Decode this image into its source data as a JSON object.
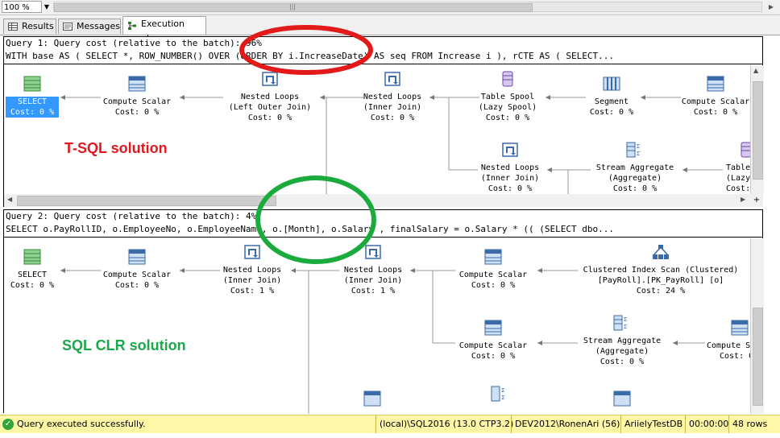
{
  "toolbar": {
    "zoom": "100 %"
  },
  "tabs": [
    {
      "label": "Results"
    },
    {
      "label": "Messages"
    },
    {
      "label": "Execution plan"
    }
  ],
  "query1": {
    "header": "Query 1: Query cost (relative to the batch): 96%",
    "sql": "WITH base AS ( SELECT *, ROW_NUMBER() OVER (ORDER BY i.IncreaseDate) AS seq FROM Increase i ), rCTE AS ( SELECT...",
    "nodes": [
      {
        "id": "select",
        "lines": [
          "SELECT",
          "Cost: 0 %"
        ],
        "icon": "select-icon"
      },
      {
        "id": "compute1",
        "lines": [
          "Compute Scalar",
          "Cost: 0 %"
        ],
        "icon": "compute-scalar-icon"
      },
      {
        "id": "nested1",
        "lines": [
          "Nested Loops",
          "(Left Outer Join)",
          "Cost: 0 %"
        ],
        "icon": "nested-loops-icon"
      },
      {
        "id": "nested2",
        "lines": [
          "Nested Loops",
          "(Inner Join)",
          "Cost: 0 %"
        ],
        "icon": "nested-loops-icon"
      },
      {
        "id": "spool",
        "lines": [
          "Table Spool",
          "(Lazy Spool)",
          "Cost: 0 %"
        ],
        "icon": "table-spool-icon"
      },
      {
        "id": "segment",
        "lines": [
          "Segment",
          "Cost: 0 %"
        ],
        "icon": "segment-icon"
      },
      {
        "id": "compute2",
        "lines": [
          "Compute Scalar",
          "Cost: 0 %"
        ],
        "icon": "compute-scalar-icon"
      },
      {
        "id": "nested3",
        "lines": [
          "Nested Loops",
          "(Inner Join)",
          "Cost: 0 %"
        ],
        "icon": "nested-loops-icon"
      },
      {
        "id": "stream1",
        "lines": [
          "Stream Aggregate",
          "(Aggregate)",
          "Cost: 0 %"
        ],
        "icon": "stream-aggregate-icon"
      },
      {
        "id": "spool2",
        "lines": [
          "Table",
          "(Lazy",
          "Cost:"
        ],
        "icon": "table-spool-icon"
      }
    ],
    "annotation": "T-SQL solution"
  },
  "query2": {
    "header": "Query 2: Query cost (relative to the batch): 4%",
    "sql": "SELECT o.PayRollID, o.EmployeeNo, o.EmployeeName, o.[Month], o.Salary , finalSalary = o.Salary * (( (SELECT dbo...",
    "nodes": [
      {
        "id": "select",
        "lines": [
          "SELECT",
          "Cost: 0 %"
        ],
        "icon": "select-icon"
      },
      {
        "id": "compute1",
        "lines": [
          "Compute Scalar",
          "Cost: 0 %"
        ],
        "icon": "compute-scalar-icon"
      },
      {
        "id": "nested1",
        "lines": [
          "Nested Loops",
          "(Inner Join)",
          "Cost: 1 %"
        ],
        "icon": "nested-loops-icon"
      },
      {
        "id": "nested2",
        "lines": [
          "Nested Loops",
          "(Inner Join)",
          "Cost: 1 %"
        ],
        "icon": "nested-loops-icon"
      },
      {
        "id": "compute2",
        "lines": [
          "Compute Scalar",
          "Cost: 0 %"
        ],
        "icon": "compute-scalar-icon"
      },
      {
        "id": "clustered",
        "lines": [
          "Clustered Index Scan (Clustered)",
          "[PayRoll].[PK_PayRoll] [o]",
          "Cost: 24 %"
        ],
        "icon": "clustered-index-scan-icon"
      },
      {
        "id": "compute3",
        "lines": [
          "Compute Scalar",
          "Cost: 0 %"
        ],
        "icon": "compute-scalar-icon"
      },
      {
        "id": "stream1",
        "lines": [
          "Stream Aggregate",
          "(Aggregate)",
          "Cost: 0 %"
        ],
        "icon": "stream-aggregate-icon"
      },
      {
        "id": "compute4",
        "lines": [
          "Compute S",
          "Cost: 0"
        ],
        "icon": "compute-scalar-icon"
      }
    ],
    "annotation": "SQL CLR solution"
  },
  "status": {
    "message": "Query executed successfully.",
    "server": "(local)\\SQL2016 (13.0 CTP3.2)",
    "user": "DEV2012\\RonenAri (56)",
    "database": "AriielyTestDB",
    "time": "00:00:00",
    "rows": "48 rows"
  },
  "colors": {
    "select_highlight": "#3399ff",
    "tsql_label": "#e0191f",
    "clr_label": "#1aa84a",
    "red_circle": "#e21a1a",
    "green_circle": "#1bab3c",
    "status_bg": "#fff6a8"
  }
}
